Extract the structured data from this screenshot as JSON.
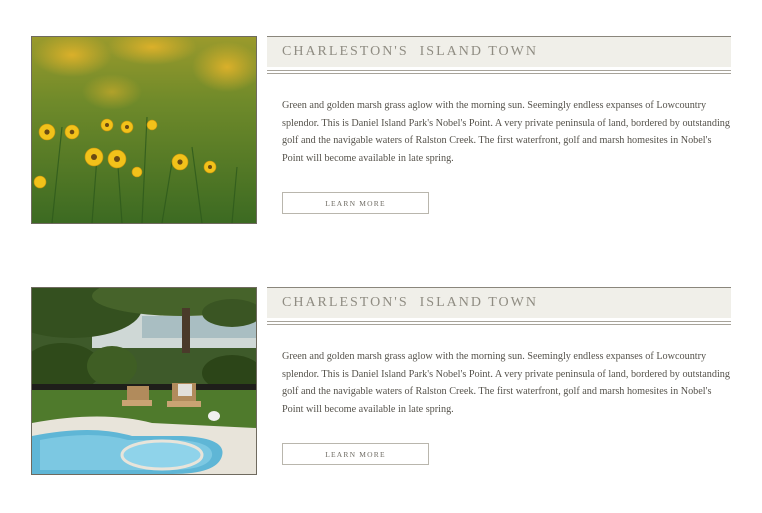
{
  "features": [
    {
      "photo": {
        "subject": "yellow marsh flowers",
        "icon": "flower-photo"
      },
      "title": "CHARLESTON'S  ISLAND TOWN",
      "body": "Green and golden marsh grass aglow with the morning sun. Seemingly endless expanses of Lowcountry splendor. This is Daniel Island Park's Nobel's Point. A very private peninsula of land, bordered by outstanding golf and the navigable waters of Ralston Creek. The first waterfront, golf and marsh homesites in Nobel's Point will become available in late spring.",
      "button_label": "LEARN MORE"
    },
    {
      "photo": {
        "subject": "backyard pool with lounge chairs",
        "icon": "pool-photo"
      },
      "title": "CHARLESTON'S  ISLAND TOWN",
      "body": "Green and golden marsh grass aglow with the morning sun. Seemingly endless expanses of Lowcountry splendor. This is Daniel Island Park's Nobel's Point. A very private peninsula of land, bordered by outstanding golf and the navigable waters of Ralston Creek. The first waterfront, golf and marsh homesites in Nobel's Point will become available in late spring.",
      "button_label": "LEARN MORE"
    }
  ],
  "colors": {
    "title_bg": "#f0efe9",
    "title_text": "#8f8c82",
    "body_text": "#55524b",
    "rule": "#a7a39a"
  }
}
